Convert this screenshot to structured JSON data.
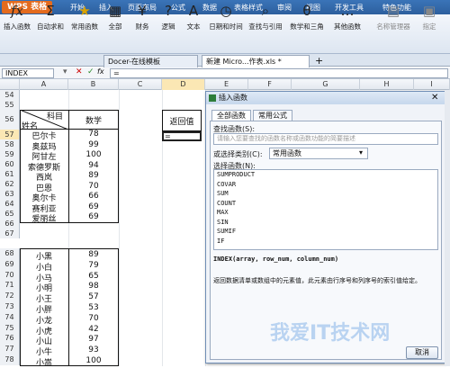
{
  "app": {
    "brand": "WPS 表格"
  },
  "menu": [
    "开始",
    "插入",
    "页面布局",
    "公式",
    "数据",
    "表格样式",
    "审阅",
    "视图",
    "开发工具",
    "特色功能"
  ],
  "ribbon": [
    {
      "icon": "fx",
      "label": "插入函数"
    },
    {
      "icon": "Σ",
      "label": "自动求和"
    },
    {
      "icon": "★",
      "label": "常用函数"
    },
    {
      "icon": "▦",
      "label": "全部"
    },
    {
      "icon": "¥",
      "label": "财务"
    },
    {
      "icon": "?",
      "label": "逻辑"
    },
    {
      "icon": "A",
      "label": "文本"
    },
    {
      "icon": "◷",
      "label": "日期和时间"
    },
    {
      "icon": "⌕",
      "label": "查找与引用"
    },
    {
      "icon": "θ",
      "label": "数学和三角"
    },
    {
      "icon": "…",
      "label": "其他函数"
    },
    {
      "icon": "▤",
      "label": "名称管理器"
    },
    {
      "icon": "▣",
      "label": "指定"
    }
  ],
  "namebox": "INDEX",
  "formula": "=",
  "doctabs": [
    "Docer-在线模板",
    "新建 Micro...作表.xls *"
  ],
  "columns": [
    "A",
    "B",
    "C",
    "D",
    "E",
    "F",
    "G",
    "H",
    "I"
  ],
  "rows_top": [
    "54",
    "55",
    "56",
    "57",
    "58",
    "59",
    "60",
    "61",
    "62",
    "63",
    "64",
    "65",
    "66",
    "67"
  ],
  "rows_bottom": [
    "68",
    "69",
    "70",
    "71",
    "72",
    "73",
    "74",
    "75",
    "76",
    "77",
    "78"
  ],
  "header": {
    "diag_top": "科目",
    "diag_bottom": "姓名",
    "math": "数学",
    "lookup": "返回值",
    "d57": "="
  },
  "table1": [
    {
      "name": "巴尔卡",
      "score": "78"
    },
    {
      "name": "奥兹玛",
      "score": "99"
    },
    {
      "name": "阿甘左",
      "score": "100"
    },
    {
      "name": "索德罗斯",
      "score": "94"
    },
    {
      "name": "西岚",
      "score": "89"
    },
    {
      "name": "巴恩",
      "score": "70"
    },
    {
      "name": "奥尔卡",
      "score": "66"
    },
    {
      "name": "赛利亚",
      "score": "69"
    },
    {
      "name": "爱丽丝",
      "score": "69"
    }
  ],
  "table2": [
    {
      "name": "小黑",
      "score": "89"
    },
    {
      "name": "小白",
      "score": "79"
    },
    {
      "name": "小马",
      "score": "65"
    },
    {
      "name": "小明",
      "score": "98"
    },
    {
      "name": "小王",
      "score": "57"
    },
    {
      "name": "小胖",
      "score": "53"
    },
    {
      "name": "小龙",
      "score": "70"
    },
    {
      "name": "小虎",
      "score": "42"
    },
    {
      "name": "小山",
      "score": "97"
    },
    {
      "name": "小牛",
      "score": "93"
    },
    {
      "name": "小嵩",
      "score": "100"
    }
  ],
  "dialog": {
    "title": "插入函数",
    "tabs": [
      "全部函数",
      "常用公式"
    ],
    "search_label": "查找函数(S):",
    "search_placeholder": "请输入您要查找的函数名称或函数功能的简要描述",
    "cat_label": "或选择类别(C):",
    "cat_value": "常用函数",
    "select_label": "选择函数(N):",
    "functions": [
      "SUMPRODUCT",
      "COVAR",
      "SUM",
      "COUNT",
      "MAX",
      "SIN",
      "SUMIF",
      "IF"
    ],
    "syntax": "INDEX(array, row_num, column_num)",
    "description": "返回数据清单或数组中的元素值，此元素由行序号和列序号的索引值给定。",
    "cancel": "取消"
  },
  "watermark": "我爱IT技术网"
}
